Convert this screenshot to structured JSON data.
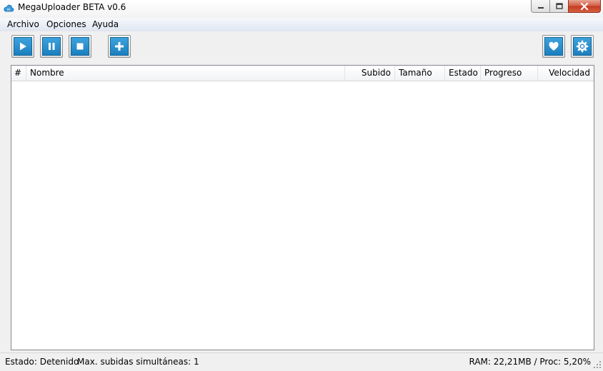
{
  "window": {
    "title": "MegaUploader BETA v0.6",
    "icon": "cloud-icon"
  },
  "menu": {
    "items": [
      "Archivo",
      "Opciones",
      "Ayuda"
    ]
  },
  "toolbar": {
    "buttons": [
      "play-icon",
      "pause-icon",
      "stop-icon",
      "plus-icon",
      "heart-icon",
      "gear-icon"
    ],
    "accent": "#1b86c9"
  },
  "list": {
    "columns": [
      "#",
      "Nombre",
      "Subido",
      "Tamaño",
      "Estado",
      "Progreso",
      "Velocidad"
    ],
    "rows": []
  },
  "status": {
    "state": "Estado: Detenido",
    "max_uploads": "Max. subidas simultáneas: 1",
    "resources": "RAM: 22,21MB / Proc: 5,20%"
  }
}
